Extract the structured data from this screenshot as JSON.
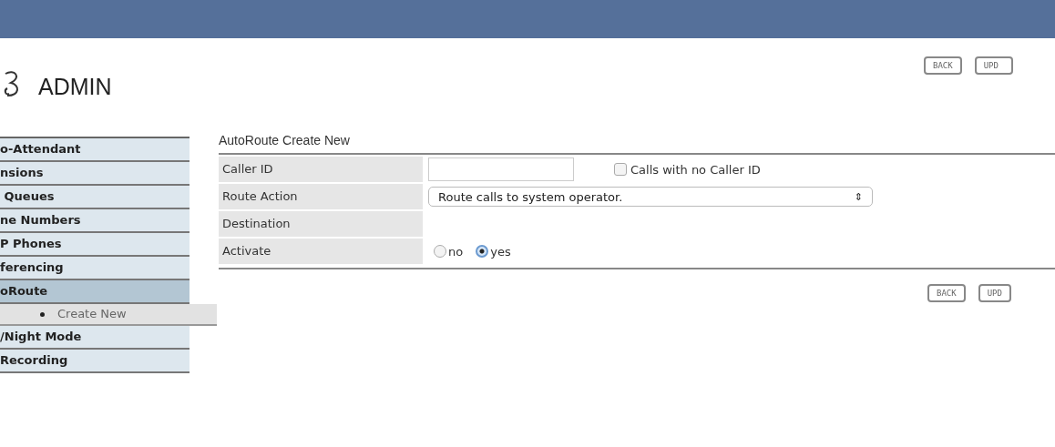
{
  "header": {
    "title": "ADMIN"
  },
  "top_buttons": [
    "BACK",
    "UPD"
  ],
  "sidebar": {
    "items": [
      {
        "label": "o-Attendant",
        "selected": false
      },
      {
        "label": "nsions",
        "selected": false
      },
      {
        "label": " Queues",
        "selected": false
      },
      {
        "label": "ne Numbers",
        "selected": false
      },
      {
        "label": "P Phones",
        "selected": false
      },
      {
        "label": "ferencing",
        "selected": false
      },
      {
        "label": "oRoute",
        "selected": true,
        "children": [
          {
            "label": "Create New",
            "selected": true
          }
        ]
      },
      {
        "label": "/Night Mode",
        "selected": false
      },
      {
        "label": "Recording",
        "selected": false
      }
    ]
  },
  "form": {
    "title": "AutoRoute Create New",
    "rows": [
      {
        "kind": "text",
        "label": "Caller ID",
        "value": "",
        "checkbox": {
          "label": "Calls with no Caller ID",
          "checked": false
        }
      },
      {
        "kind": "select",
        "label": "Route Action",
        "value": "Route calls to system operator.",
        "arrow": "⇕"
      },
      {
        "kind": "empty",
        "label": "Destination"
      },
      {
        "kind": "radio",
        "label": "Activate",
        "options": [
          {
            "label": "no",
            "selected": false
          },
          {
            "label": "yes",
            "selected": true
          }
        ]
      }
    ]
  },
  "bottom_buttons": [
    "BACK",
    "UPD"
  ]
}
